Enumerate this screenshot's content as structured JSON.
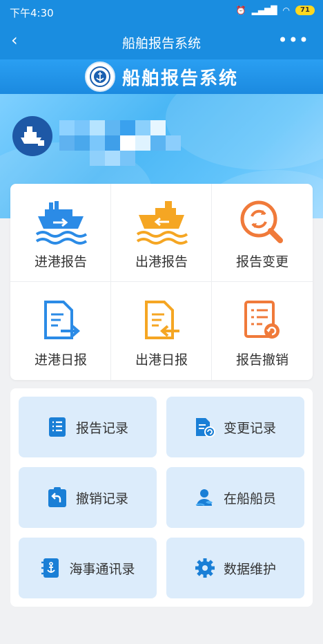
{
  "status_bar": {
    "time": "下午4:30",
    "signal": "▂▄▆█",
    "battery": "71"
  },
  "nav": {
    "back": "‹",
    "title": "船舶报告系统",
    "more": "•••"
  },
  "banner": {
    "title": "船舶报告系统"
  },
  "grid": [
    {
      "label": "进港报告",
      "icon": "ship-arrow-in-icon"
    },
    {
      "label": "出港报告",
      "icon": "ship-arrow-out-icon"
    },
    {
      "label": "报告变更",
      "icon": "refresh-search-icon"
    },
    {
      "label": "进港日报",
      "icon": "document-arrow-in-icon"
    },
    {
      "label": "出港日报",
      "icon": "document-arrow-out-icon"
    },
    {
      "label": "报告撤销",
      "icon": "document-revoke-icon"
    }
  ],
  "records": [
    {
      "label": "报告记录",
      "icon": "report-list-icon"
    },
    {
      "label": "变更记录",
      "icon": "change-record-icon"
    },
    {
      "label": "撤销记录",
      "icon": "revoke-record-icon"
    },
    {
      "label": "在船船员",
      "icon": "crew-icon"
    },
    {
      "label": "海事通讯录",
      "icon": "anchor-contacts-icon"
    },
    {
      "label": "数据维护",
      "icon": "gear-icon"
    }
  ],
  "colors": {
    "primary": "#1a8de0",
    "blue_icon": "#2b8be6",
    "orange_icon": "#f5a623",
    "red_orange_icon": "#f07a3a",
    "tile_bg": "#dcecfb"
  }
}
